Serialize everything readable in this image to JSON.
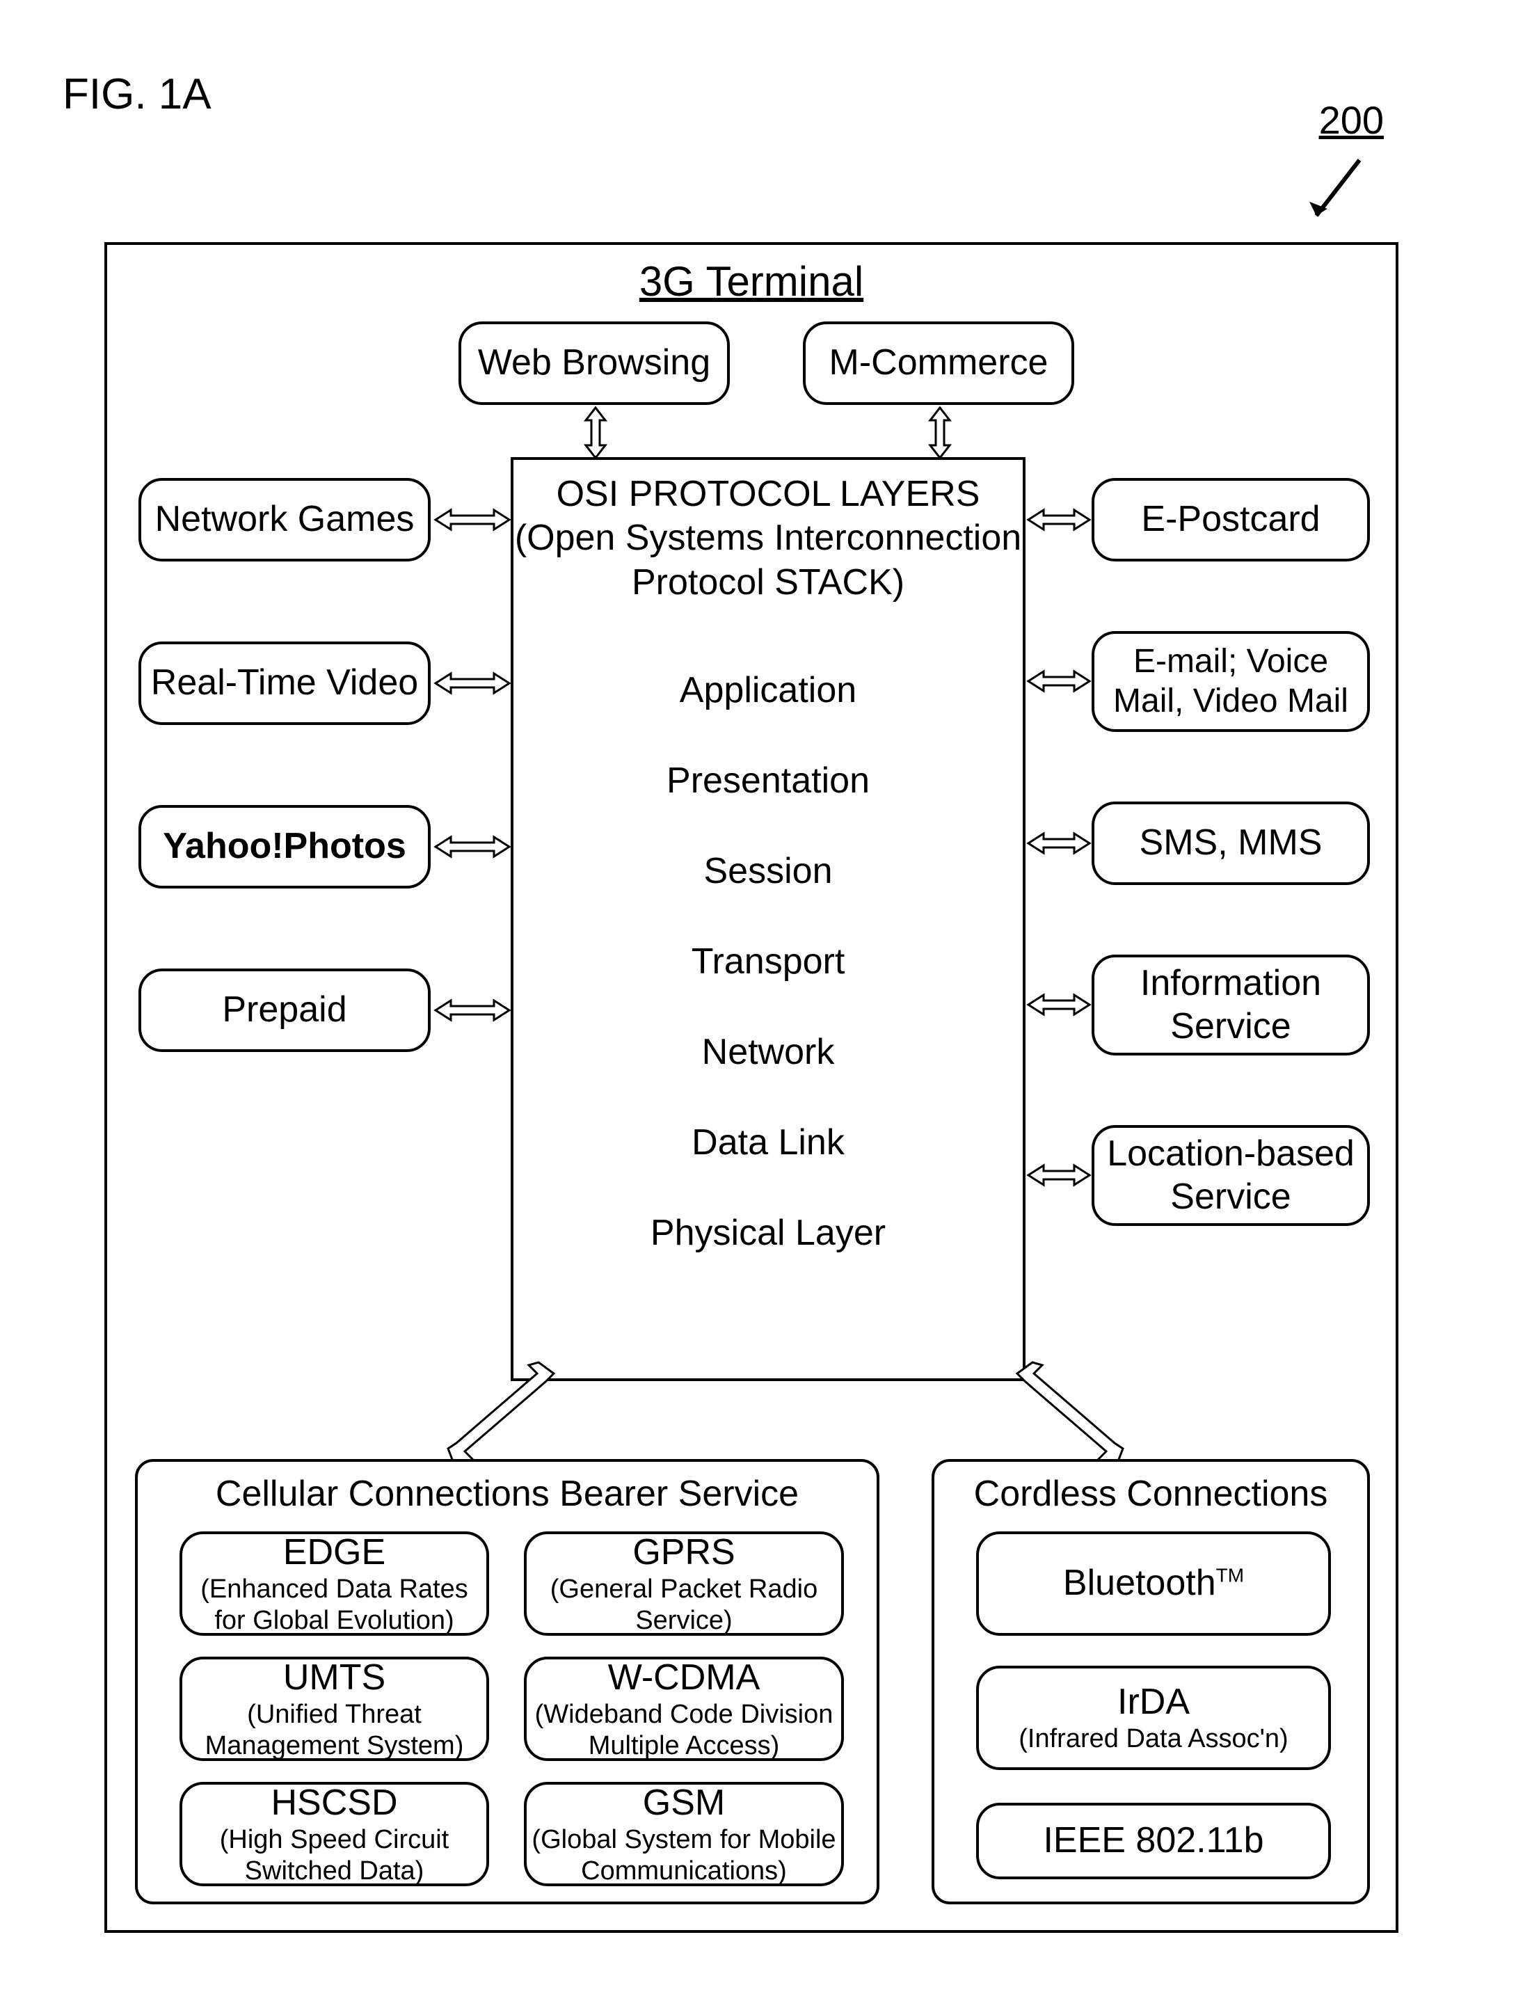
{
  "figure_label": "FIG. 1A",
  "reference_number": "200",
  "terminal_title": "3G Terminal",
  "top_apps": {
    "web_browsing": "Web Browsing",
    "m_commerce": "M-Commerce"
  },
  "center": {
    "header_line1": "OSI PROTOCOL LAYERS",
    "header_line2": "(Open Systems Interconnection",
    "header_line3": "Protocol STACK)",
    "layers": [
      "Application",
      "Presentation",
      "Session",
      "Transport",
      "Network",
      "Data Link",
      "Physical Layer"
    ]
  },
  "left_apps": [
    "Network Games",
    "Real-Time Video",
    "Yahoo!Photos",
    "Prepaid"
  ],
  "right_apps": [
    "E-Postcard",
    "E-mail; Voice Mail, Video Mail",
    "SMS, MMS",
    "Information Service",
    "Location-based Service"
  ],
  "cellular": {
    "title": "Cellular Connections Bearer Service",
    "items": [
      {
        "name": "EDGE",
        "sub": "(Enhanced Data Rates for Global Evolution)"
      },
      {
        "name": "GPRS",
        "sub": "(General Packet Radio Service)"
      },
      {
        "name": "UMTS",
        "sub": "(Unified Threat Management System)"
      },
      {
        "name": "W-CDMA",
        "sub": "(Wideband Code Division Multiple Access)"
      },
      {
        "name": "HSCSD",
        "sub": "(High Speed Circuit Switched Data)"
      },
      {
        "name": "GSM",
        "sub": "(Global System for Mobile Communications)"
      }
    ]
  },
  "cordless": {
    "title": "Cordless Connections",
    "items": [
      {
        "name": "Bluetooth",
        "tm": "TM",
        "sub": ""
      },
      {
        "name": "IrDA",
        "tm": "",
        "sub": "(Infrared Data Assoc'n)"
      },
      {
        "name": "IEEE 802.11b",
        "tm": "",
        "sub": ""
      }
    ]
  }
}
